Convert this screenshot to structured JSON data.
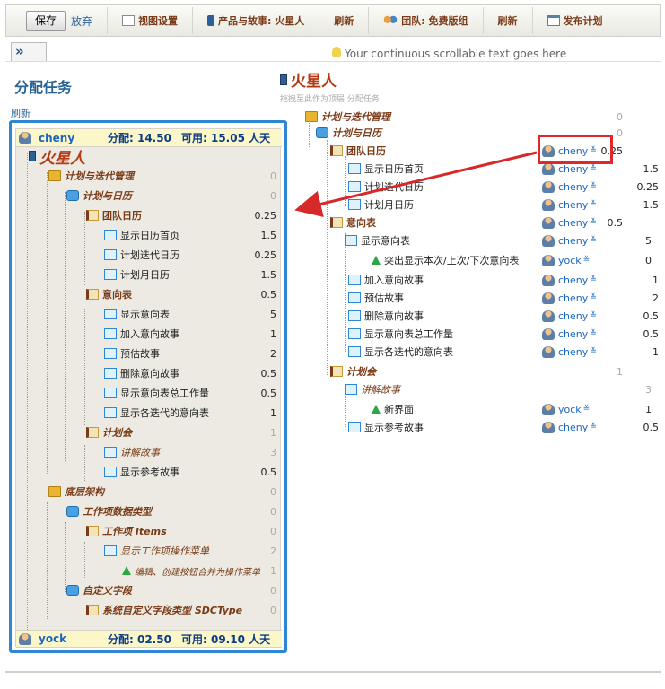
{
  "toolbar": {
    "save_label": "保存",
    "discard_label": "放弃",
    "view_settings": "视图设置",
    "product_story_label": "产品与故事: 火星人",
    "refresh1": "刷新",
    "team_label": "团队: 免费版组",
    "refresh2": "刷新",
    "release_plan": "发布计划"
  },
  "collapse_button": "»",
  "tip_text": "Your continuous scrollable text goes here",
  "left": {
    "title": "分配任务",
    "refresh": "刷新",
    "users": [
      {
        "name": "cheny",
        "assign": "分配: 14.50",
        "avail": "可用: 15.05 人天"
      },
      {
        "name": "yock",
        "assign": "分配: 02.50",
        "avail": "可用: 09.10 人天"
      }
    ],
    "rows": [
      {
        "label": "火星人",
        "value": ""
      },
      {
        "label": "计划与迭代管理",
        "value": "0"
      },
      {
        "label": "计划与日历",
        "value": "0"
      },
      {
        "label": "团队日历",
        "value": "0.25"
      },
      {
        "label": "显示日历首页",
        "value": "1.5"
      },
      {
        "label": "计划迭代日历",
        "value": "0.25"
      },
      {
        "label": "计划月日历",
        "value": "1.5"
      },
      {
        "label": "意向表",
        "value": "0.5"
      },
      {
        "label": "显示意向表",
        "value": "5"
      },
      {
        "label": "加入意向故事",
        "value": "1"
      },
      {
        "label": "预估故事",
        "value": "2"
      },
      {
        "label": "删除意向故事",
        "value": "0.5"
      },
      {
        "label": "显示意向表总工作量",
        "value": "0.5"
      },
      {
        "label": "显示各迭代的意向表",
        "value": "1"
      },
      {
        "label": "计划会",
        "value": "1"
      },
      {
        "label": "讲解故事",
        "value": "3"
      },
      {
        "label": "显示参考故事",
        "value": "0.5"
      },
      {
        "label": "底层架构",
        "value": "0"
      },
      {
        "label": "工作项数据类型",
        "value": "0"
      },
      {
        "label": "工作项 Items",
        "value": "0"
      },
      {
        "label": "显示工作项操作菜单",
        "value": "2"
      },
      {
        "label": "编辑、创建按钮合并为操作菜单",
        "value": "1"
      },
      {
        "label": "自定义字段",
        "value": "0"
      },
      {
        "label": "系统自定义字段类型 SDCType",
        "value": "0"
      }
    ]
  },
  "story": {
    "title": "火星人",
    "subtitle": "拖拽至此作为顶层 分配任务"
  },
  "right": {
    "rows": [
      {
        "label": "计划与迭代管理",
        "user": "",
        "value": "0"
      },
      {
        "label": "计划与日历",
        "user": "",
        "value": "0"
      },
      {
        "label": "团队日历",
        "user": "cheny",
        "value": "0.25"
      },
      {
        "label": "显示日历首页",
        "user": "cheny",
        "value": "1.5"
      },
      {
        "label": "计划迭代日历",
        "user": "cheny",
        "value": "0.25"
      },
      {
        "label": "计划月日历",
        "user": "cheny",
        "value": "1.5"
      },
      {
        "label": "意向表",
        "user": "cheny",
        "value": "0.5"
      },
      {
        "label": "显示意向表",
        "user": "cheny",
        "value": "5"
      },
      {
        "label": "突出显示本次/上次/下次意向表",
        "user": "yock",
        "value": "0"
      },
      {
        "label": "加入意向故事",
        "user": "cheny",
        "value": "1"
      },
      {
        "label": "预估故事",
        "user": "cheny",
        "value": "2"
      },
      {
        "label": "删除意向故事",
        "user": "cheny",
        "value": "0.5"
      },
      {
        "label": "显示意向表总工作量",
        "user": "cheny",
        "value": "0.5"
      },
      {
        "label": "显示各迭代的意向表",
        "user": "cheny",
        "value": "1"
      },
      {
        "label": "计划会",
        "user": "",
        "value": "1"
      },
      {
        "label": "讲解故事",
        "user": "",
        "value": "3"
      },
      {
        "label": "新界面",
        "user": "yock",
        "value": "1"
      },
      {
        "label": "显示参考故事",
        "user": "cheny",
        "value": "0.5"
      }
    ]
  },
  "colors": {
    "highlight": "#e0272a",
    "panel_border": "#2f86d4",
    "link": "#1a66bf"
  }
}
